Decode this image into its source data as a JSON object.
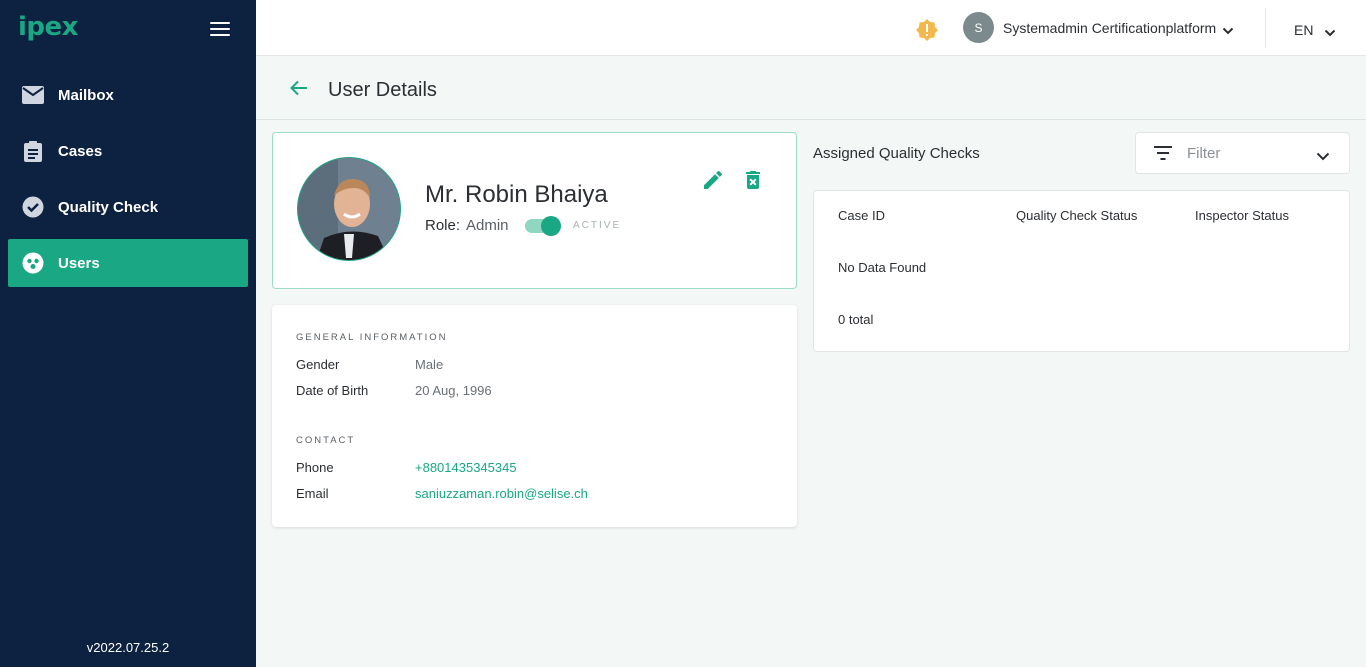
{
  "app": {
    "logo": "ipex",
    "version": "v2022.07.25.2"
  },
  "sidebar": {
    "items": [
      {
        "label": "Mailbox",
        "icon": "mail-icon",
        "active": false
      },
      {
        "label": "Cases",
        "icon": "clipboard-icon",
        "active": false
      },
      {
        "label": "Quality Check",
        "icon": "check-circle-icon",
        "active": false
      },
      {
        "label": "Users",
        "icon": "users-icon",
        "active": true
      }
    ]
  },
  "topbar": {
    "user_initial": "S",
    "user_name": "Systemadmin Certificationplatform",
    "language": "EN"
  },
  "page": {
    "title": "User Details"
  },
  "profile": {
    "name": "Mr. Robin Bhaiya",
    "role_label": "Role:",
    "role_value": "Admin",
    "status": "ACTIVE"
  },
  "general": {
    "heading": "GENERAL INFORMATION",
    "gender_label": "Gender",
    "gender_value": "Male",
    "dob_label": "Date of Birth",
    "dob_value": "20 Aug, 1996"
  },
  "contact": {
    "heading": "CONTACT",
    "phone_label": "Phone",
    "phone_value": "+8801435345345",
    "email_label": "Email",
    "email_value": "saniuzzaman.robin@selise.ch"
  },
  "quality_checks": {
    "title": "Assigned Quality Checks",
    "filter_label": "Filter",
    "columns": [
      "Case ID",
      "Quality Check Status",
      "Inspector Status"
    ],
    "empty_text": "No Data Found",
    "total_text": "0 total"
  },
  "colors": {
    "accent": "#1aa784",
    "sidebar": "#0d2240",
    "warning": "#f2b84b"
  }
}
